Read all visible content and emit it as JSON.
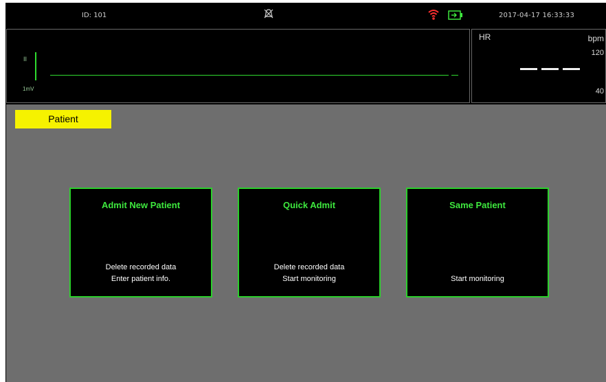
{
  "status_bar": {
    "patient_id": "ID: 101",
    "alarm_icon": "alarm-off-icon",
    "wifi_icon": "wifi-icon",
    "battery_icon": "battery-icon",
    "datetime": "2017-04-17  16:33:33"
  },
  "ecg": {
    "lead": "II",
    "scale": "1mV",
    "trace_color": "#2fdc2f"
  },
  "hr": {
    "label": "HR",
    "unit": "bpm",
    "upper_limit": "120",
    "lower_limit": "40",
    "value_display": "---"
  },
  "tabs": {
    "patient": "Patient"
  },
  "options": [
    {
      "title": "Admit New Patient",
      "lines": [
        "Delete recorded data",
        "Enter patient info."
      ]
    },
    {
      "title": "Quick Admit",
      "lines": [
        "Delete recorded data",
        "Start monitoring"
      ]
    },
    {
      "title": "Same Patient",
      "lines": [
        "",
        "Start monitoring"
      ]
    }
  ],
  "colors": {
    "accent_green": "#3ee83e",
    "tab_yellow": "#f6f200",
    "content_bg": "#6e6e6e",
    "screen_bg": "#000000"
  }
}
